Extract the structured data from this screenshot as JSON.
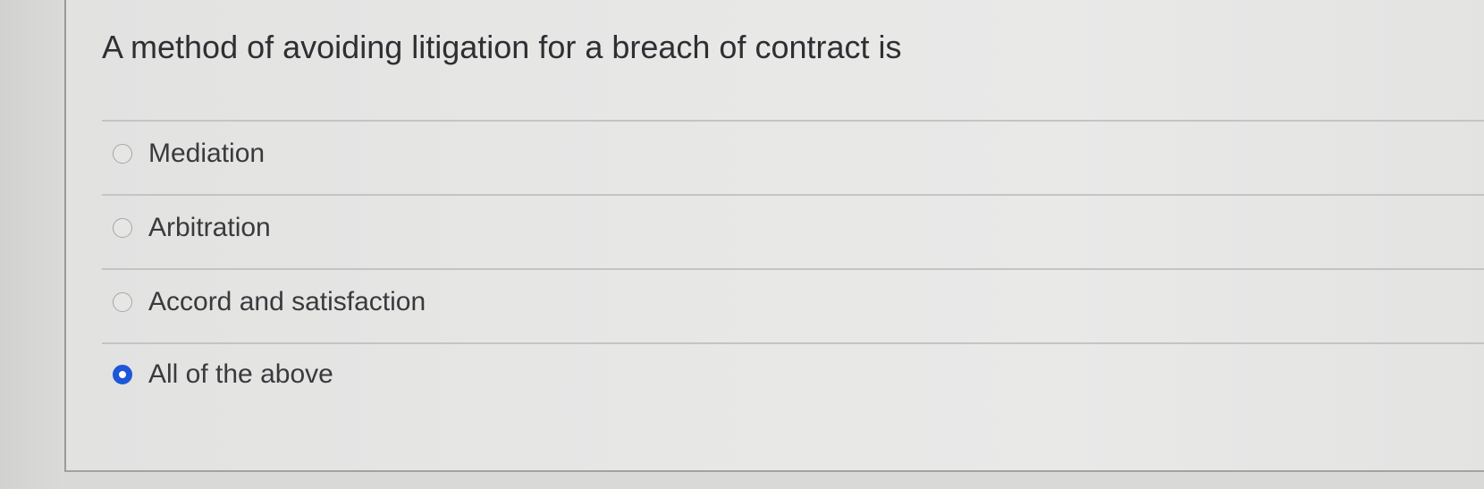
{
  "question": {
    "text": "A method of avoiding litigation for a breach of contract is"
  },
  "options": [
    {
      "label": "Mediation",
      "selected": false
    },
    {
      "label": "Arbitration",
      "selected": false
    },
    {
      "label": "Accord and satisfaction",
      "selected": false
    },
    {
      "label": "All of the above",
      "selected": true
    }
  ],
  "colors": {
    "selected_radio": "#1d56d8"
  }
}
